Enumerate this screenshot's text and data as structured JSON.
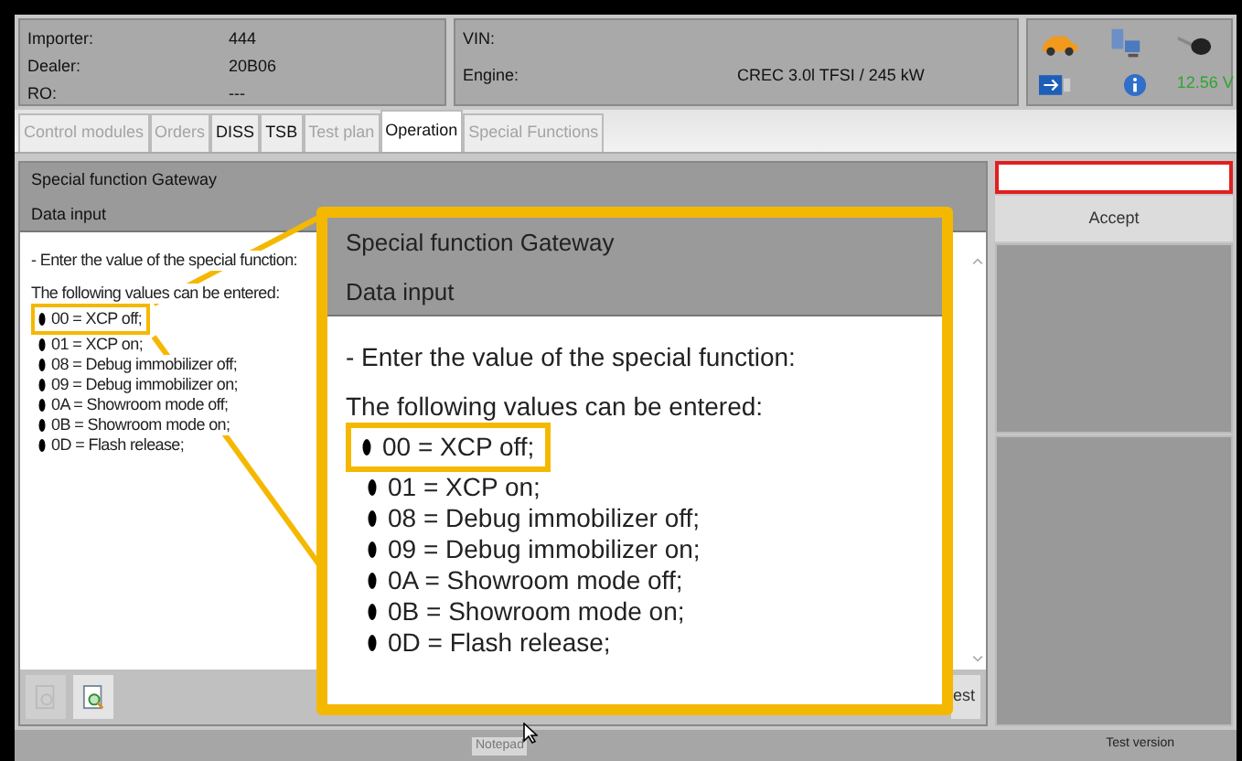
{
  "header": {
    "customer": [
      {
        "label": "Importer:",
        "value": "444"
      },
      {
        "label": "Dealer:",
        "value": "20B06"
      },
      {
        "label": "RO:",
        "value": "---"
      }
    ],
    "vehicle": [
      {
        "label": "VIN:"
      },
      {
        "label": "Engine:",
        "value": "CREC 3.0l TFSI / 245 kW"
      }
    ],
    "voltage": "12.56 V"
  },
  "tabs": [
    {
      "label": "Control modules",
      "selected": false,
      "disabled": true
    },
    {
      "label": "Orders",
      "selected": false,
      "disabled": true
    },
    {
      "label": "DISS",
      "selected": false,
      "disabled": false
    },
    {
      "label": "TSB",
      "selected": false,
      "disabled": false
    },
    {
      "label": "Test plan",
      "selected": false,
      "disabled": true
    },
    {
      "label": "Operation",
      "selected": true,
      "disabled": false
    },
    {
      "label": "Special Functions",
      "selected": false,
      "disabled": true
    }
  ],
  "panel": {
    "title": "Special function Gateway",
    "subtitle": "Data input",
    "intro": "- Enter the value of the special function:",
    "values_heading": "The following values can be entered:",
    "values": [
      {
        "text": "00 = XCP off;",
        "highlighted": true
      },
      {
        "text": "01 = XCP on;",
        "highlighted": false
      },
      {
        "text": "08 = Debug immobilizer off;",
        "highlighted": false
      },
      {
        "text": "09 = Debug immobilizer on;",
        "highlighted": false
      },
      {
        "text": "0A = Showroom mode off;",
        "highlighted": false
      },
      {
        "text": "0B = Showroom mode on;",
        "highlighted": false
      },
      {
        "text": "0D = Flash release;",
        "highlighted": false
      }
    ],
    "test_button": "est"
  },
  "callout": {
    "title": "Special function Gateway",
    "subtitle": "Data input",
    "intro": "- Enter the value of the special function:",
    "values_heading": "The following values can be entered:",
    "values": [
      {
        "text": "00 = XCP off;",
        "highlighted": true
      },
      {
        "text": "01 = XCP on;",
        "highlighted": false
      },
      {
        "text": "08 = Debug immobilizer off;",
        "highlighted": false
      },
      {
        "text": "09 = Debug immobilizer on;",
        "highlighted": false
      },
      {
        "text": "0A = Showroom mode off;",
        "highlighted": false
      },
      {
        "text": "0B = Showroom mode on;",
        "highlighted": false
      },
      {
        "text": "0D = Flash release;",
        "highlighted": false
      }
    ]
  },
  "side": {
    "accept": "Accept"
  },
  "status_bar": {
    "notepad": "Notepad",
    "version": "Test version"
  }
}
